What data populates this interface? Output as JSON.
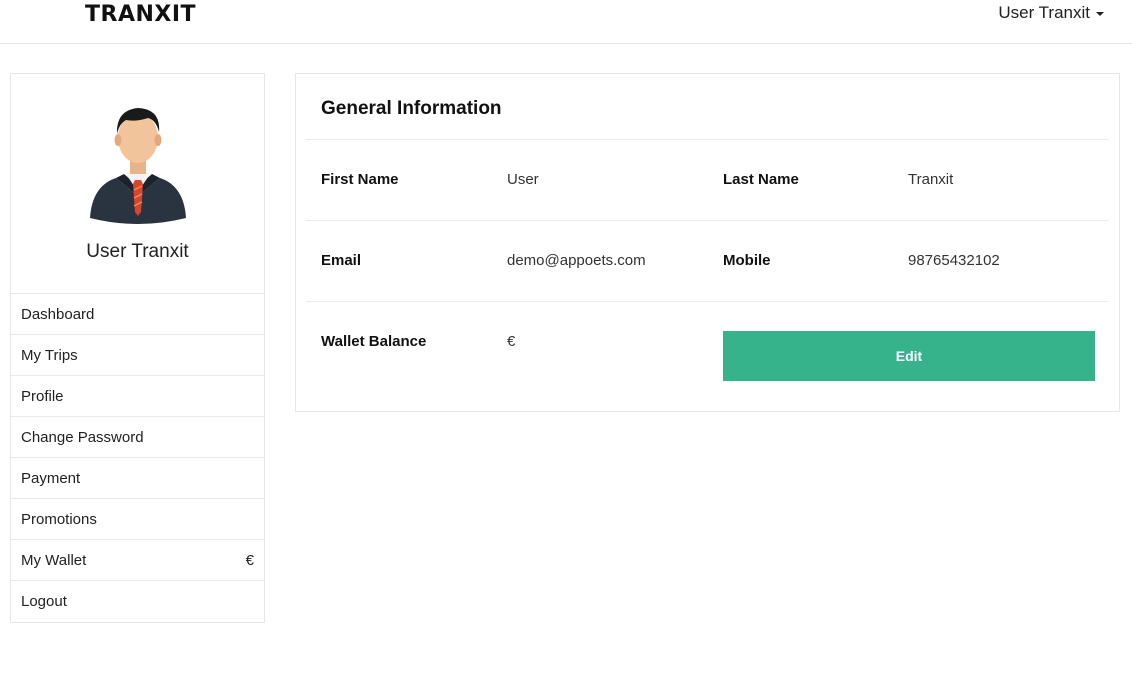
{
  "header": {
    "brand": "TRANXIT",
    "user_menu_label": "User Tranxit"
  },
  "sidebar": {
    "profile_name": "User Tranxit",
    "items": [
      {
        "label": "Dashboard",
        "badge": ""
      },
      {
        "label": "My Trips",
        "badge": ""
      },
      {
        "label": "Profile",
        "badge": ""
      },
      {
        "label": "Change Password",
        "badge": ""
      },
      {
        "label": "Payment",
        "badge": ""
      },
      {
        "label": "Promotions",
        "badge": ""
      },
      {
        "label": "My Wallet",
        "badge": "€"
      },
      {
        "label": "Logout",
        "badge": ""
      }
    ]
  },
  "general_info": {
    "title": "General Information",
    "first_name_label": "First Name",
    "first_name": "User",
    "last_name_label": "Last Name",
    "last_name": "Tranxit",
    "email_label": "Email",
    "email": "demo@appoets.com",
    "mobile_label": "Mobile",
    "mobile": "98765432102",
    "wallet_label": "Wallet Balance",
    "wallet_value": "€",
    "edit_label": "Edit"
  },
  "colors": {
    "accent": "#37b38b",
    "border": "#e6e6e6"
  }
}
